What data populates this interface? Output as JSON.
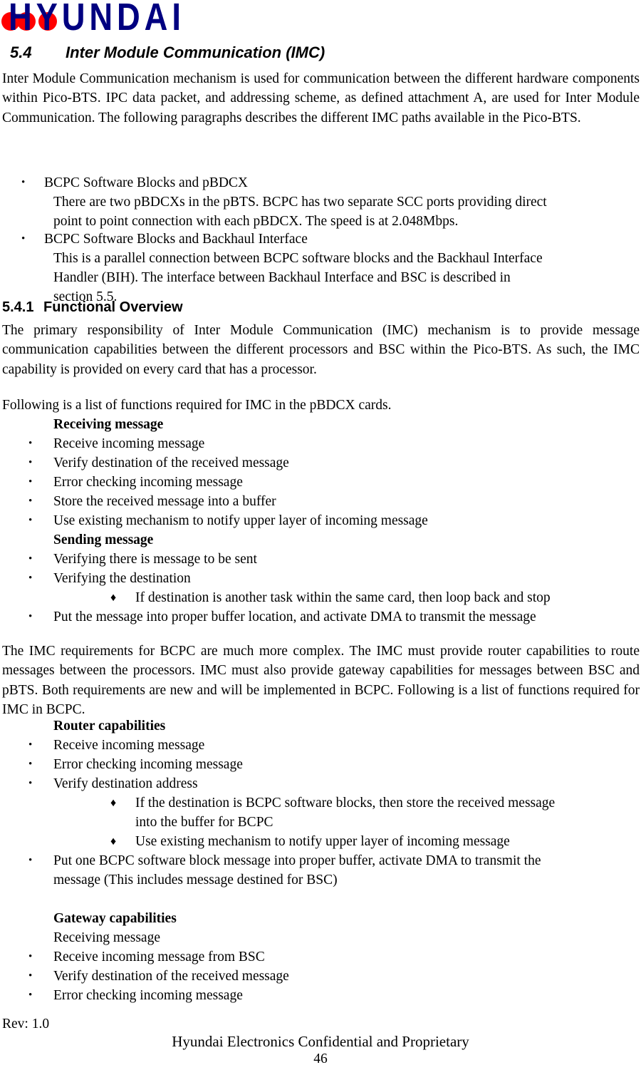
{
  "logo": {
    "brand": "HYUNDAI",
    "dot_color": "#FF0000",
    "text_color": "#000080",
    "dot_count": 3
  },
  "headings": {
    "section_54_number": "5.4",
    "section_54_title": "Inter Module Communication (IMC)",
    "section_541_number": "5.4.1",
    "section_541_title": "Functional Overview"
  },
  "intro_paragraph": "Inter Module Communication mechanism is used for communication between the different hardware components within Pico-BTS.  IPC data packet, and addressing scheme, as defined attachment A, are used for Inter Module Communication.  The following paragraphs describes the different IMC paths available in the Pico-BTS.",
  "imc_paths": [
    {
      "bullet": "•",
      "title": "BCPC  Software Blocks and pBDCX",
      "body": "There are two pBDCXs in the pBTS. BCPC has two separate SCC ports providing direct point to point connection with each pBDCX.  The speed is at 2.048Mbps."
    },
    {
      "bullet": "•",
      "title": "BCPC Software Blocks and Backhaul Interface",
      "body": "This is a parallel connection between BCPC software blocks and the Backhaul Interface Handler (BIH).  The interface between Backhaul Interface and BSC is described in section 5.5."
    }
  ],
  "functional_overview_paragraph": "The primary responsibility of Inter Module Communication (IMC) mechanism is to provide message communication capabilities between the different processors and BSC within the Pico-BTS.  As such, the IMC capability is provided on every card that has a processor.",
  "pbdcx_intro": "Following is a list of functions required for IMC in the pBDCX cards.",
  "pbdcx_sections": [
    {
      "header": "Receiving message",
      "header_bold": true,
      "items": [
        {
          "bullet": "•",
          "text": "Receive incoming message"
        },
        {
          "bullet": "•",
          "text": "Verify destination of the received message"
        },
        {
          "bullet": "•",
          "text": "Error checking incoming message"
        },
        {
          "bullet": "•",
          "text": "Store the received message into a buffer"
        },
        {
          "bullet": "•",
          "text": "Use existing mechanism to notify upper layer of incoming message"
        }
      ]
    },
    {
      "header": "Sending message",
      "header_bold": true,
      "items": [
        {
          "bullet": "•",
          "text": "Verifying there is message to be sent"
        },
        {
          "bullet": "•",
          "text": "Verifying the destination"
        },
        {
          "bullet": "♦",
          "text": "If destination is another task within the same card, then loop back and stop",
          "sub": true
        },
        {
          "bullet": "•",
          "text": "Put the message into proper buffer location, and activate DMA to transmit the message"
        }
      ]
    }
  ],
  "bcpc_paragraph": "The IMC requirements for BCPC are much more complex.  The IMC must provide router capabilities to route messages between the processors.  IMC must also provide gateway capabilities for messages between BSC and pBTS.  Both requirements are new and will be implemented in BCPC.  Following is a list of functions required for IMC in BCPC.",
  "bcpc_sections": [
    {
      "header": "Router capabilities",
      "header_bold": true,
      "items": [
        {
          "bullet": "•",
          "text": "Receive incoming message"
        },
        {
          "bullet": "•",
          "text": "Error checking incoming message"
        },
        {
          "bullet": "•",
          "text": "Verify destination address"
        },
        {
          "bullet": "♦",
          "text": "If the destination is BCPC software blocks, then store the received message into the buffer for BCPC",
          "sub": true
        },
        {
          "bullet": "♦",
          "text": "Use existing mechanism to notify upper layer of incoming message",
          "sub": true
        },
        {
          "bullet": "•",
          "text": "Put one BCPC software block message into proper buffer, activate DMA to transmit the message (This includes message destined for BSC)"
        }
      ]
    },
    {
      "header": "Gateway capabilities",
      "header_bold": true,
      "subheader": "Receiving message",
      "subheader_bold": false,
      "items": [
        {
          "bullet": "•",
          "text": "Receive incoming message from BSC"
        },
        {
          "bullet": "•",
          "text": "Verify destination of the received message"
        },
        {
          "bullet": "•",
          "text": "Error checking incoming message"
        }
      ]
    }
  ],
  "body_lines": {
    "imc_path1_l1": "There are two pBDCXs in the pBTS. BCPC has two separate SCC ports providing direct",
    "imc_path1_l2": "point to point connection with each pBDCX.  The speed is at 2.048Mbps.",
    "imc_path2_l1": "This is a parallel connection between BCPC software blocks and the Backhaul Interface",
    "imc_path2_l2": "Handler (BIH).   The interface between Backhaul Interface and BSC is described in",
    "imc_path2_l3": "section 5.5.",
    "sub1_l1": "If destination is another task within the same card, then loop back and stop",
    "put_msg_l1": "Put the message into proper buffer location, and activate DMA to transmit the message",
    "router_sub1_l1": "If the destination is BCPC software blocks, then store the received message",
    "router_sub1_l2": "into the buffer for BCPC",
    "router_sub2_l1": "Use existing mechanism to notify upper layer of incoming message",
    "router_put_l1": "Put one BCPC software block message into proper buffer, activate DMA to transmit the",
    "router_put_l2": "message (This includes message destined for BSC)"
  },
  "footer": {
    "revision": "Rev: 1.0",
    "confidential": "Hyundai Electronics Confidential and Proprietary",
    "page_number": "46"
  }
}
